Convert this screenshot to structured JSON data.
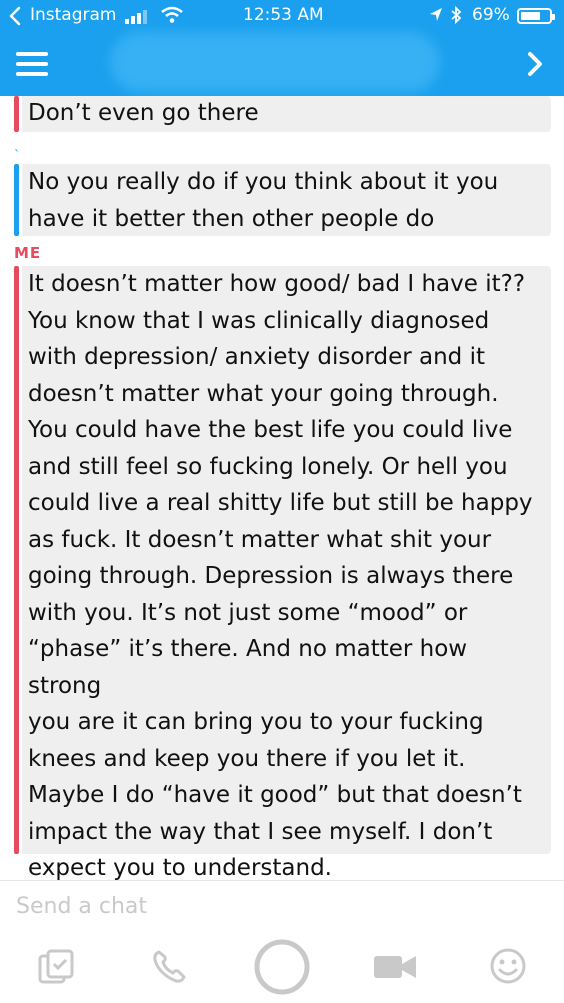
{
  "status_bar": {
    "back_app": "Instagram",
    "time": "12:53 AM",
    "battery_percent": "69%",
    "battery_level": 0.69
  },
  "header": {
    "menu_icon": "hamburger-menu-icon",
    "forward_icon": "chevron-right-icon"
  },
  "messages": [
    {
      "text": "Don’t even go there",
      "bar_color": "#e84a5f"
    },
    {
      "text": "No you really do if you think about it you\nhave it better then other people do",
      "bar_color": "#1aa0ee"
    },
    {
      "sender": "ME",
      "text": "It doesn’t matter how good/ bad I have it??\nYou know that I was clinically diagnosed\nwith depression/ anxiety disorder and it\ndoesn’t matter what your going through.\nYou could have the best life you could live\nand still feel so fucking lonely. Or hell you\ncould live a real shitty life but still be happy\nas fuck. It doesn’t matter what shit your\ngoing through. Depression is always there\nwith you. It’s not just some “mood” or\n“phase” it’s there. And no matter how strong\nyou are it can bring you to your fucking\nknees and keep you there if you let it.\nMaybe I do “have it good” but that doesn’t\nimpact the way that I see myself. I don’t\nexpect you to understand.",
      "bar_color": "#e84a5f"
    }
  ],
  "composer": {
    "placeholder": "Send a chat"
  },
  "toolbar": {
    "icons": [
      "memories-icon",
      "phone-icon",
      "capture-button-icon",
      "video-camera-icon",
      "emoji-icon"
    ]
  }
}
